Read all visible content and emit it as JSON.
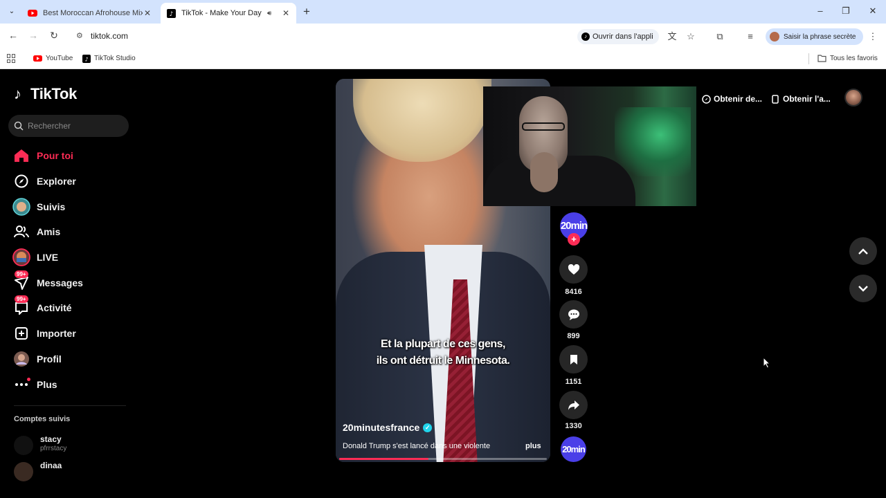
{
  "browser": {
    "tabs": [
      {
        "title": "Best Moroccan Afrohouse Mix...",
        "favicon": "youtube-icon",
        "active": false
      },
      {
        "title": "TikTok - Make Your Day",
        "favicon": "tiktok-icon",
        "active": true
      }
    ],
    "url": "tiktok.com",
    "open_in_app": "Ouvrir dans l'appli",
    "passphrase_chip": "Saisir la phrase secrète",
    "bookmarks": [
      {
        "label": "YouTube",
        "icon": "youtube-icon"
      },
      {
        "label": "TikTok Studio",
        "icon": "tiktok-icon"
      }
    ],
    "all_bookmarks": "Tous les favoris"
  },
  "tiktok": {
    "logo": "TikTok",
    "search_placeholder": "Rechercher",
    "nav": [
      {
        "label": "Pour toi",
        "icon": "home-icon",
        "active": true
      },
      {
        "label": "Explorer",
        "icon": "compass-icon"
      },
      {
        "label": "Suivis",
        "icon": "following-avatar-icon"
      },
      {
        "label": "Amis",
        "icon": "friends-icon"
      },
      {
        "label": "LIVE",
        "icon": "live-avatar-icon"
      },
      {
        "label": "Messages",
        "icon": "messages-icon",
        "badge": "99+"
      },
      {
        "label": "Activité",
        "icon": "activity-icon",
        "badge": "99+"
      },
      {
        "label": "Importer",
        "icon": "upload-icon"
      },
      {
        "label": "Profil",
        "icon": "profile-avatar-icon"
      },
      {
        "label": "Plus",
        "icon": "more-dots-icon"
      }
    ],
    "followed_title": "Comptes suivis",
    "followed": [
      {
        "name": "stacy",
        "username": "pfrrstacy"
      },
      {
        "name": "dinaa",
        "username": ""
      }
    ],
    "header_ctas": [
      "Obtenir de...",
      "Obtenir l'a..."
    ],
    "video": {
      "subtitle_line1": "Et la plupart de ces gens,",
      "subtitle_line2": "ils ont détruit le Minnesota.",
      "author": "20minutesfrance",
      "description": "Donald Trump s'est lancé dans une violente",
      "more": "plus",
      "progress": 0.43
    },
    "creator_logo": "20min",
    "actions": {
      "likes": "8416",
      "comments": "899",
      "saves": "1151",
      "shares": "1330"
    },
    "colors": {
      "accent": "#fe2c55",
      "creator": "#4a3fe8",
      "verified": "#20d5ec"
    }
  }
}
